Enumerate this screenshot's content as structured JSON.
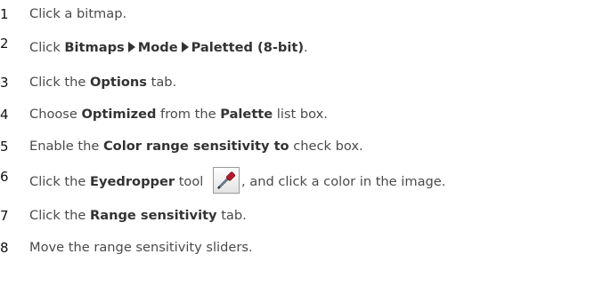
{
  "steps": [
    {
      "number": "1",
      "parts": [
        "Click a bitmap."
      ]
    },
    {
      "number": "2",
      "parts": [
        "Click ",
        "Bitmaps",
        "Mode",
        "Paletted (8-bit)",
        "."
      ]
    },
    {
      "number": "3",
      "parts": [
        "Click the ",
        "Options",
        " tab."
      ]
    },
    {
      "number": "4",
      "parts": [
        "Choose ",
        "Optimized",
        " from the ",
        "Palette",
        " list box."
      ]
    },
    {
      "number": "5",
      "parts": [
        "Enable the ",
        "Color range sensitivity to",
        " check box."
      ]
    },
    {
      "number": "6",
      "parts": [
        "Click the ",
        "Eyedropper",
        " tool ",
        ", and click a color in the image."
      ],
      "icon": "eyedropper-icon"
    },
    {
      "number": "7",
      "parts": [
        "Click the ",
        "Range sensitivity",
        " tab."
      ]
    },
    {
      "number": "8",
      "parts": [
        "Move the range sensitivity sliders."
      ]
    }
  ],
  "colors": {
    "text": "#4a4a4a",
    "emphasis": "#333333",
    "icon_accent": "#c0142c"
  }
}
